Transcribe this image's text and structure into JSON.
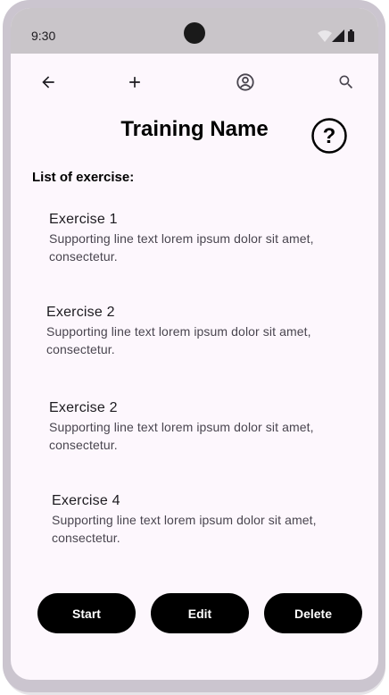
{
  "status_bar": {
    "time": "9:30"
  },
  "app_bar": {
    "back_icon": "arrow-left-icon",
    "add_icon": "plus-icon",
    "profile_icon": "account-circle-icon",
    "search_icon": "search-icon"
  },
  "page": {
    "title": "Training Name",
    "help_icon": "help-circle-icon",
    "list_header": "List of exercise:"
  },
  "exercises": [
    {
      "title": "Exercise 1",
      "subtitle": "Supporting line text lorem ipsum dolor sit amet, consectetur."
    },
    {
      "title": "Exercise 2",
      "subtitle": "Supporting line text lorem ipsum dolor sit amet, consectetur."
    },
    {
      "title": "Exercise 2",
      "subtitle": "Supporting line text lorem ipsum dolor sit amet, consectetur."
    },
    {
      "title": "Exercise 4",
      "subtitle": "Supporting line text lorem ipsum dolor sit amet, consectetur."
    }
  ],
  "actions": {
    "start": "Start",
    "edit": "Edit",
    "delete": "Delete"
  },
  "colors": {
    "screen_background": "#fdf7fd",
    "status_bar": "#c9c5c9",
    "button_background": "#000000",
    "button_text": "#ffffff"
  }
}
